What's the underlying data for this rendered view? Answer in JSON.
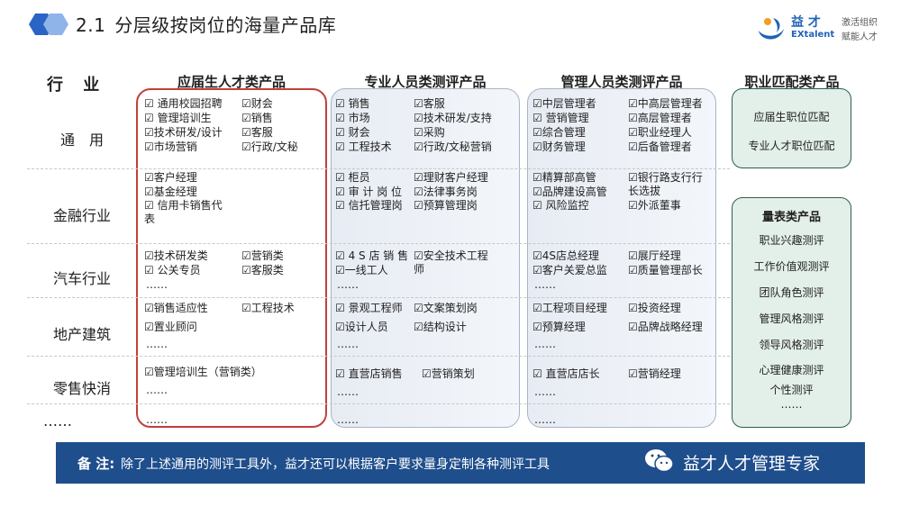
{
  "header": {
    "number": "2.1",
    "title": "分层级按岗位的海量产品库"
  },
  "brand": {
    "name_cn": "益 才",
    "name_en": "EXtalent",
    "slogan_line1": "激活组织",
    "slogan_line2": "赋能人才"
  },
  "table": {
    "industry_header": "行 业",
    "columns": [
      "应届生人才类产品",
      "专业人员类测评产品",
      "管理人员类测评产品",
      "职业匹配类产品"
    ],
    "rows": [
      "通　用",
      "金融行业",
      "汽车行业",
      "地产建筑",
      "零售快消",
      "……"
    ]
  },
  "col1": {
    "r1": [
      "☑ 通用校园招聘",
      "☑财会",
      "☑ 管理培训生",
      "☑销售",
      "☑技术研发/设计",
      "☑客服",
      "☑市场营销",
      "☑行政/文秘"
    ],
    "r2": [
      "☑客户经理",
      "☑基金经理",
      "☑ 信用卡销售代表"
    ],
    "r3": [
      "☑技术研发类",
      "☑营销类",
      "☑ 公关专员",
      "☑客服类",
      "……"
    ],
    "r4": [
      "☑销售适应性",
      "☑工程技术",
      "☑置业顾问",
      "……"
    ],
    "r5": [
      "☑管理培训生（营销类）",
      "……"
    ],
    "r6": [
      "……"
    ]
  },
  "col2": {
    "r1": [
      "☑ 销售",
      "☑客服",
      "☑ 市场",
      "☑技术研发/支持",
      "☑ 财会",
      "☑采购",
      "☑ 工程技术",
      "☑行政/文秘营销"
    ],
    "r2": [
      "☑ 柜员",
      "☑理财客户经理",
      "☑ 审 计 岗 位",
      "☑法律事务岗",
      "☑ 信托管理岗",
      "☑预算管理岗"
    ],
    "r3": [
      "☑ 4 S 店 销 售",
      "☑安全技术工程师",
      "☑一线工人",
      "……"
    ],
    "r4": [
      "☑ 景观工程师",
      "☑文案策划岗",
      "☑设计人员",
      "☑结构设计",
      "……"
    ],
    "r5": [
      "☑ 直营店销售",
      "☑营销策划",
      "……"
    ],
    "r6": [
      "……"
    ]
  },
  "col3": {
    "r1": [
      "☑中层管理者",
      "☑中高层管理者",
      "☑ 营销管理",
      "☑高层管理者",
      "☑综合管理",
      "☑职业经理人",
      "☑财务管理",
      "☑后备管理者"
    ],
    "r2": [
      "☑精算部高管",
      "☑银行路支行行长选拔",
      "☑品牌建设高管",
      "☑ 风险监控",
      "☑外派董事"
    ],
    "r3": [
      "☑4S店总经理",
      "☑展厅经理",
      "☑客户关爱总监",
      "☑质量管理部长",
      "……"
    ],
    "r4": [
      "☑工程项目经理",
      "☑投资经理",
      "☑预算经理",
      "☑品牌战略经理",
      "……"
    ],
    "r5": [
      "☑ 直营店店长",
      "☑营销经理",
      "……"
    ],
    "r6": [
      "……"
    ]
  },
  "match": {
    "items": [
      "应届生职位匹配",
      "专业人才职位匹配"
    ]
  },
  "scale": {
    "title": "量表类产品",
    "items": [
      "职业兴趣测评",
      "工作价值观测评",
      "团队角色测评",
      "管理风格测评",
      "领导风格测评",
      "心理健康测评",
      "个性测评",
      "……"
    ]
  },
  "note": {
    "label": "备 注:",
    "text": "除了上述通用的测评工具外，益才还可以根据客户要求量身定制各种测评工具",
    "wechat_text": "益才人才管理专家"
  },
  "colors": {
    "accent_blue": "#1f4e8c",
    "red_border": "#c0413b",
    "green_border": "#2f5e4f"
  },
  "icons": [
    "hexagon-logo-icon",
    "extalent-logo-icon",
    "wechat-icon"
  ]
}
